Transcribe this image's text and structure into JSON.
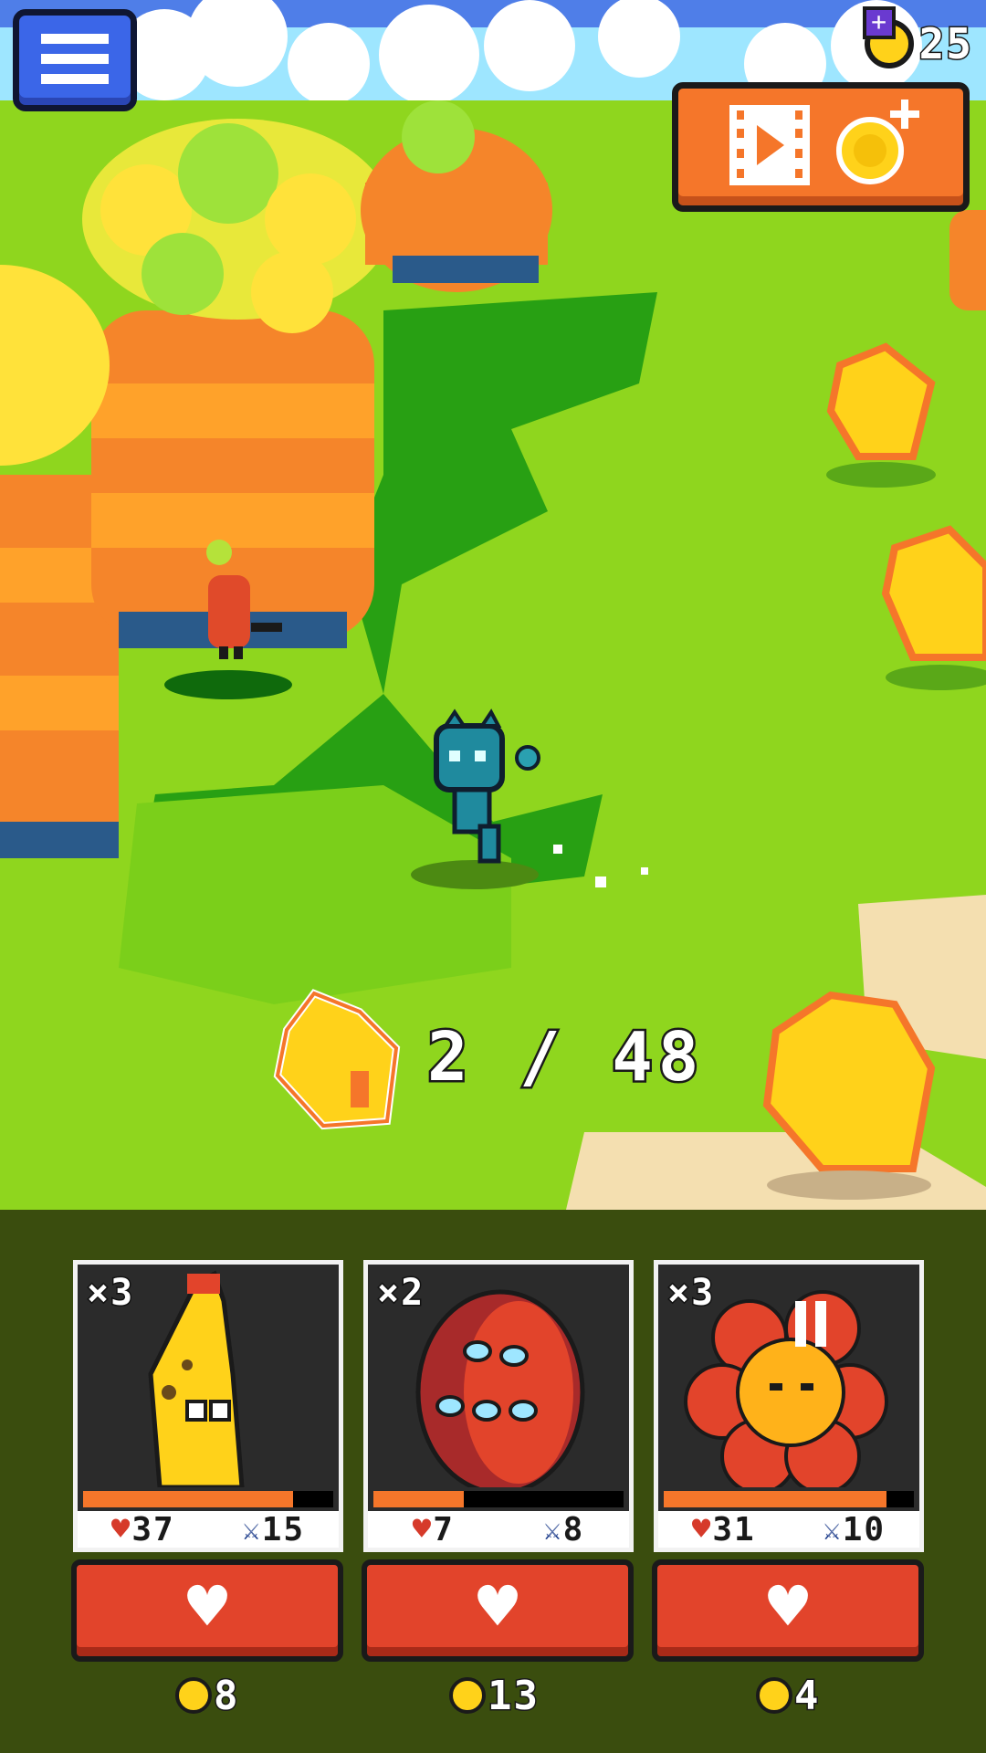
{
  "hud": {
    "coins": "25",
    "menu_icon": "hamburger-menu-icon",
    "video_reward_icon": "video-coin-plus-icon"
  },
  "counter": {
    "text": "2 / 48",
    "icon": "yellow-leaf-icon"
  },
  "team": [
    {
      "rank": "×3",
      "hp": "37",
      "attack": "15",
      "health_fraction": 0.84,
      "heal_cost": "8",
      "creature": "banana-creature"
    },
    {
      "rank": "×2",
      "hp": "7",
      "attack": "8",
      "health_fraction": 0.36,
      "heal_cost": "13",
      "creature": "red-many-eyed-creature"
    },
    {
      "rank": "×3",
      "hp": "31",
      "attack": "10",
      "health_fraction": 0.89,
      "heal_cost": "4",
      "creature": "red-flower-creature"
    }
  ],
  "colors": {
    "accent_orange": "#f5762a",
    "heal_red": "#e2442b",
    "menu_blue": "#3b66e8",
    "coin_yellow": "#ffd21a"
  }
}
